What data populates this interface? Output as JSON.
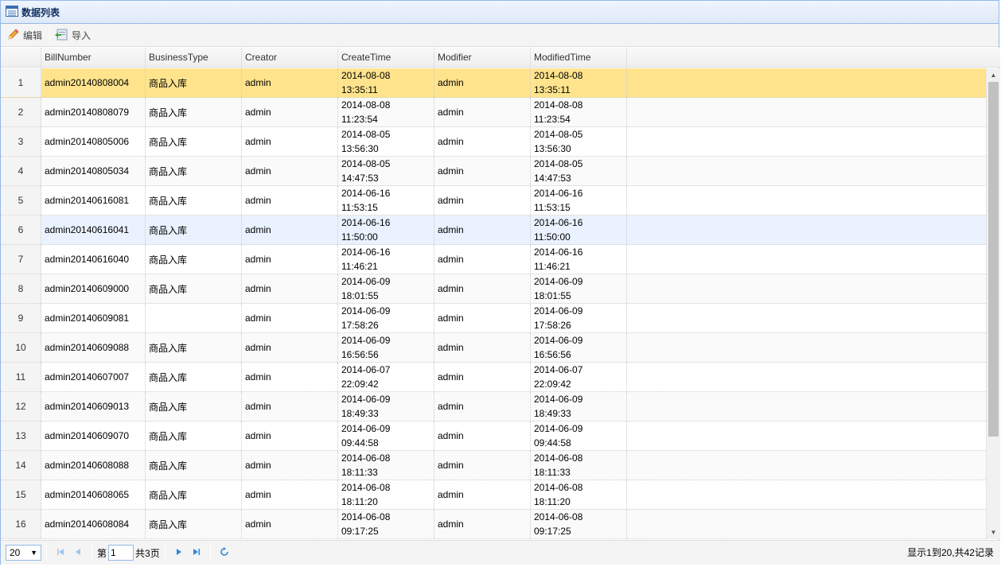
{
  "panel": {
    "title": "数据列表",
    "icon": "list-icon"
  },
  "toolbar": {
    "edit_label": "编辑",
    "import_label": "导入"
  },
  "columns": [
    "BillNumber",
    "BusinessType",
    "Creator",
    "CreateTime",
    "Modifier",
    "ModifiedTime"
  ],
  "rows": [
    {
      "num": "1",
      "bill": "admin20140808004",
      "type": "商品入库",
      "creator": "admin",
      "ct1": "2014-08-08",
      "ct2": "13:35:11",
      "modifier": "admin",
      "mt1": "2014-08-08",
      "mt2": "13:35:11"
    },
    {
      "num": "2",
      "bill": "admin20140808079",
      "type": "商品入库",
      "creator": "admin",
      "ct1": "2014-08-08",
      "ct2": "11:23:54",
      "modifier": "admin",
      "mt1": "2014-08-08",
      "mt2": "11:23:54"
    },
    {
      "num": "3",
      "bill": "admin20140805006",
      "type": "商品入库",
      "creator": "admin",
      "ct1": "2014-08-05",
      "ct2": "13:56:30",
      "modifier": "admin",
      "mt1": "2014-08-05",
      "mt2": "13:56:30"
    },
    {
      "num": "4",
      "bill": "admin20140805034",
      "type": "商品入库",
      "creator": "admin",
      "ct1": "2014-08-05",
      "ct2": "14:47:53",
      "modifier": "admin",
      "mt1": "2014-08-05",
      "mt2": "14:47:53"
    },
    {
      "num": "5",
      "bill": "admin20140616081",
      "type": "商品入库",
      "creator": "admin",
      "ct1": "2014-06-16",
      "ct2": "11:53:15",
      "modifier": "admin",
      "mt1": "2014-06-16",
      "mt2": "11:53:15"
    },
    {
      "num": "6",
      "bill": "admin20140616041",
      "type": "商品入库",
      "creator": "admin",
      "ct1": "2014-06-16",
      "ct2": "11:50:00",
      "modifier": "admin",
      "mt1": "2014-06-16",
      "mt2": "11:50:00"
    },
    {
      "num": "7",
      "bill": "admin20140616040",
      "type": "商品入库",
      "creator": "admin",
      "ct1": "2014-06-16",
      "ct2": "11:46:21",
      "modifier": "admin",
      "mt1": "2014-06-16",
      "mt2": "11:46:21"
    },
    {
      "num": "8",
      "bill": "admin20140609000",
      "type": "商品入库",
      "creator": "admin",
      "ct1": "2014-06-09",
      "ct2": "18:01:55",
      "modifier": "admin",
      "mt1": "2014-06-09",
      "mt2": "18:01:55"
    },
    {
      "num": "9",
      "bill": "admin20140609081",
      "type": "",
      "creator": "admin",
      "ct1": "2014-06-09",
      "ct2": "17:58:26",
      "modifier": "admin",
      "mt1": "2014-06-09",
      "mt2": "17:58:26"
    },
    {
      "num": "10",
      "bill": "admin20140609088",
      "type": "商品入库",
      "creator": "admin",
      "ct1": "2014-06-09",
      "ct2": "16:56:56",
      "modifier": "admin",
      "mt1": "2014-06-09",
      "mt2": "16:56:56"
    },
    {
      "num": "11",
      "bill": "admin20140607007",
      "type": "商品入库",
      "creator": "admin",
      "ct1": "2014-06-07",
      "ct2": "22:09:42",
      "modifier": "admin",
      "mt1": "2014-06-07",
      "mt2": "22:09:42"
    },
    {
      "num": "12",
      "bill": "admin20140609013",
      "type": "商品入库",
      "creator": "admin",
      "ct1": "2014-06-09",
      "ct2": "18:49:33",
      "modifier": "admin",
      "mt1": "2014-06-09",
      "mt2": "18:49:33"
    },
    {
      "num": "13",
      "bill": "admin20140609070",
      "type": "商品入库",
      "creator": "admin",
      "ct1": "2014-06-09",
      "ct2": "09:44:58",
      "modifier": "admin",
      "mt1": "2014-06-09",
      "mt2": "09:44:58"
    },
    {
      "num": "14",
      "bill": "admin20140608088",
      "type": "商品入库",
      "creator": "admin",
      "ct1": "2014-06-08",
      "ct2": "18:11:33",
      "modifier": "admin",
      "mt1": "2014-06-08",
      "mt2": "18:11:33"
    },
    {
      "num": "15",
      "bill": "admin20140608065",
      "type": "商品入库",
      "creator": "admin",
      "ct1": "2014-06-08",
      "ct2": "18:11:20",
      "modifier": "admin",
      "mt1": "2014-06-08",
      "mt2": "18:11:20"
    },
    {
      "num": "16",
      "bill": "admin20140608084",
      "type": "商品入库",
      "creator": "admin",
      "ct1": "2014-06-08",
      "ct2": "09:17:25",
      "modifier": "admin",
      "mt1": "2014-06-08",
      "mt2": "09:17:25"
    }
  ],
  "selected_row": 0,
  "hover_row": 5,
  "pager": {
    "page_size": "20",
    "page_prefix": "第",
    "page_value": "1",
    "page_total": "共3页",
    "info": "显示1到20,共42记录"
  },
  "colors": {
    "selected": "#ffe48d",
    "hover": "#eaf2ff",
    "border": "#95b8e7",
    "icon_blue": "#2e8ad8"
  }
}
